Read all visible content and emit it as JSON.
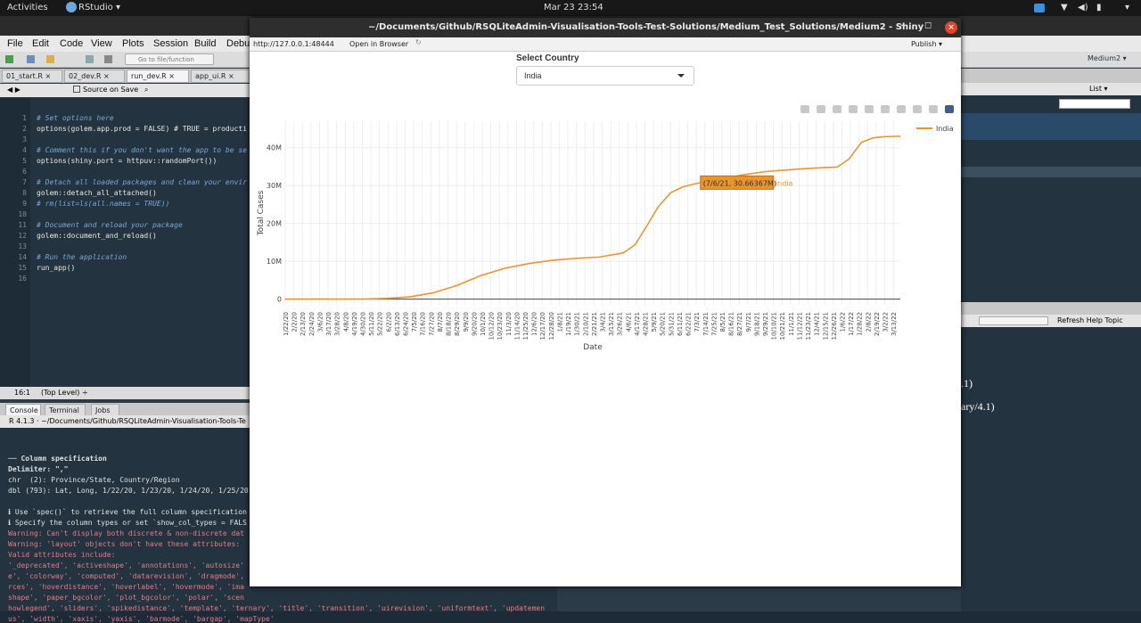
{
  "topbar": {
    "activities": "Activities",
    "app": "RStudio ▾",
    "clock": "Mar 23  23:54"
  },
  "menu": [
    "File",
    "Edit",
    "Code",
    "View",
    "Plots",
    "Session",
    "Build",
    "Debug"
  ],
  "toolbar": {
    "goto": "Go to file/function",
    "project": "Medium2 ▾"
  },
  "tabs": [
    "01_start.R",
    "02_dev.R",
    "run_dev.R",
    "app_ui.R"
  ],
  "editor_bar": {
    "source_on_save": "Source on Save"
  },
  "editor_lines": [
    {
      "n": "1",
      "t": "# Set options here",
      "c": true
    },
    {
      "n": "2",
      "t": "options(golem.app.prod = FALSE) # TRUE = producti",
      "c": false
    },
    {
      "n": "3",
      "t": "",
      "c": false
    },
    {
      "n": "4",
      "t": "# Comment this if you don't want the app to be se",
      "c": true
    },
    {
      "n": "5",
      "t": "options(shiny.port = httpuv::randomPort())",
      "c": false
    },
    {
      "n": "6",
      "t": "",
      "c": false
    },
    {
      "n": "7",
      "t": "# Detach all loaded packages and clean your envir",
      "c": true
    },
    {
      "n": "8",
      "t": "golem::detach_all_attached()",
      "c": false
    },
    {
      "n": "9",
      "t": "# rm(list=ls(all.names = TRUE))",
      "c": true
    },
    {
      "n": "10",
      "t": "",
      "c": false
    },
    {
      "n": "11",
      "t": "# Document and reload your package",
      "c": true
    },
    {
      "n": "12",
      "t": "golem::document_and_reload()",
      "c": false
    },
    {
      "n": "13",
      "t": "",
      "c": false
    },
    {
      "n": "14",
      "t": "# Run the application",
      "c": true
    },
    {
      "n": "15",
      "t": "run_app()",
      "c": false
    },
    {
      "n": "16",
      "t": "",
      "c": false
    }
  ],
  "status": {
    "pos": "16:1",
    "level": "(Top Level) ÷"
  },
  "console_tabs": [
    "Console",
    "Terminal ×",
    "Jobs ×"
  ],
  "console_header": "R 4.1.3 · ~/Documents/Github/RSQLiteAdmin-Visualisation-Tools-Te",
  "console_lines": [
    {
      "t": "── Column specification",
      "k": "b"
    },
    {
      "t": "Delimiter: \",\"",
      "k": "b"
    },
    {
      "t": "chr  (2): Province/State, Country/Region",
      "k": ""
    },
    {
      "t": "dbl (793): Lat, Long, 1/22/20, 1/23/20, 1/24/20, 1/25/20",
      "k": ""
    },
    {
      "t": "",
      "k": ""
    },
    {
      "t": "ℹ Use `spec()` to retrieve the full column specification",
      "k": ""
    },
    {
      "t": "ℹ Specify the column types or set `show_col_types = FALS",
      "k": ""
    },
    {
      "t": "Warning: Can't display both discrete & non-discrete dat",
      "k": "warn"
    },
    {
      "t": "Warning: 'layout' objects don't have these attributes:",
      "k": "warn"
    },
    {
      "t": "Valid attributes include:",
      "k": "warn"
    },
    {
      "t": "'_deprecated', 'activeshape', 'annotations', 'autosize'",
      "k": "warn"
    },
    {
      "t": "e', 'colorway', 'computed', 'datarevision', 'dragmode',",
      "k": "warn"
    },
    {
      "t": "rces', 'hoverdistance', 'hoverlabel', 'hovermode', 'ima",
      "k": "warn"
    },
    {
      "t": "shape', 'paper_bgcolor', 'plot_bgcolor', 'polar', 'scen",
      "k": "warn"
    },
    {
      "t": "howlegend', 'sliders', 'spikedistance', 'template', 'ternary', 'title', 'transition', 'uirevision', 'uniformtext', 'updatemen",
      "k": "warn"
    },
    {
      "t": "us', 'width', 'xaxis', 'yaxis', 'barmode', 'bargap', 'mapType'",
      "k": "warn"
    }
  ],
  "right_panel": {
    "list": "List ▾",
    "refresh": "Refresh Help Topic",
    "frag1": ".1)",
    "frag2": "ary/4.1)"
  },
  "window": {
    "title": "~/Documents/Github/RSQLiteAdmin-Visualisation-Tools-Test-Solutions/Medium_Test_Solutions/Medium2 - Shiny",
    "url": "http://127.0.0.1:48444",
    "open_browser": "Open in Browser",
    "publish": "Publish ▾"
  },
  "shiny": {
    "label": "Select Country",
    "selected": "India"
  },
  "colors": {
    "line": "#e8952f",
    "accent": "#d4451e"
  },
  "chart_data": {
    "type": "line",
    "xlabel": "Date",
    "ylabel": "Total Cases",
    "ylim": [
      -1500000,
      47000000
    ],
    "yticks": [
      {
        "v": 0,
        "l": "0"
      },
      {
        "v": 10000000,
        "l": "10M"
      },
      {
        "v": 20000000,
        "l": "20M"
      },
      {
        "v": 30000000,
        "l": "30M"
      },
      {
        "v": 40000000,
        "l": "40M"
      }
    ],
    "xticks": [
      "1/22/20",
      "2/2/20",
      "2/13/20",
      "2/24/20",
      "3/6/20",
      "3/17/20",
      "3/28/20",
      "4/8/20",
      "4/19/20",
      "4/30/20",
      "5/11/20",
      "5/22/20",
      "6/2/20",
      "6/13/20",
      "6/24/20",
      "7/5/20",
      "7/16/20",
      "7/27/20",
      "8/7/20",
      "8/18/20",
      "8/29/20",
      "9/9/20",
      "9/20/20",
      "10/1/20",
      "10/12/20",
      "10/23/20",
      "11/3/20",
      "11/14/20",
      "11/25/20",
      "12/6/20",
      "12/17/20",
      "12/28/20",
      "1/8/21",
      "1/19/21",
      "1/30/21",
      "2/10/21",
      "2/21/21",
      "3/4/21",
      "3/15/21",
      "3/26/21",
      "4/6/21",
      "4/17/21",
      "4/28/21",
      "5/9/21",
      "5/20/21",
      "5/31/21",
      "6/11/21",
      "6/22/21",
      "7/3/21",
      "7/14/21",
      "7/25/21",
      "8/5/21",
      "8/16/21",
      "8/27/21",
      "9/7/21",
      "9/18/21",
      "9/29/21",
      "10/10/21",
      "10/21/21",
      "11/1/21",
      "11/12/21",
      "11/23/21",
      "12/4/21",
      "12/15/21",
      "12/26/21",
      "1/6/22",
      "1/17/22",
      "1/28/22",
      "2/8/22",
      "2/19/22",
      "3/2/22",
      "3/13/22"
    ],
    "series": [
      {
        "name": "India",
        "color": "#e8952f",
        "points": [
          [
            "1/22/20",
            0
          ],
          [
            "2/24/20",
            0
          ],
          [
            "3/28/20",
            1000
          ],
          [
            "4/30/20",
            35000
          ],
          [
            "5/31/20",
            190000
          ],
          [
            "6/30/20",
            590000
          ],
          [
            "7/31/20",
            1700000
          ],
          [
            "8/31/20",
            3700000
          ],
          [
            "9/30/20",
            6300000
          ],
          [
            "10/31/20",
            8200000
          ],
          [
            "11/30/20",
            9400000
          ],
          [
            "12/31/20",
            10300000
          ],
          [
            "1/31/21",
            10800000
          ],
          [
            "2/28/21",
            11100000
          ],
          [
            "3/31/21",
            12200000
          ],
          [
            "4/15/21",
            14300000
          ],
          [
            "4/30/21",
            19200000
          ],
          [
            "5/15/21",
            24400000
          ],
          [
            "5/31/21",
            28100000
          ],
          [
            "6/15/21",
            29600000
          ],
          [
            "6/30/21",
            30400000
          ],
          [
            "7/6/21",
            30663665
          ],
          [
            "7/31/21",
            31600000
          ],
          [
            "8/31/21",
            32800000
          ],
          [
            "9/30/21",
            33700000
          ],
          [
            "10/31/21",
            34200000
          ],
          [
            "11/30/21",
            34600000
          ],
          [
            "12/31/21",
            34900000
          ],
          [
            "1/15/22",
            37000000
          ],
          [
            "1/31/22",
            41400000
          ],
          [
            "2/15/22",
            42600000
          ],
          [
            "2/28/22",
            42900000
          ],
          [
            "3/13/22",
            43000000
          ],
          [
            "3/22/22",
            43010000
          ]
        ]
      }
    ],
    "tooltip": {
      "text": "(7/6/21, 30.66367M)",
      "x": "7/6/21",
      "y": 30663665,
      "series": "India"
    },
    "legend": "top-right"
  }
}
